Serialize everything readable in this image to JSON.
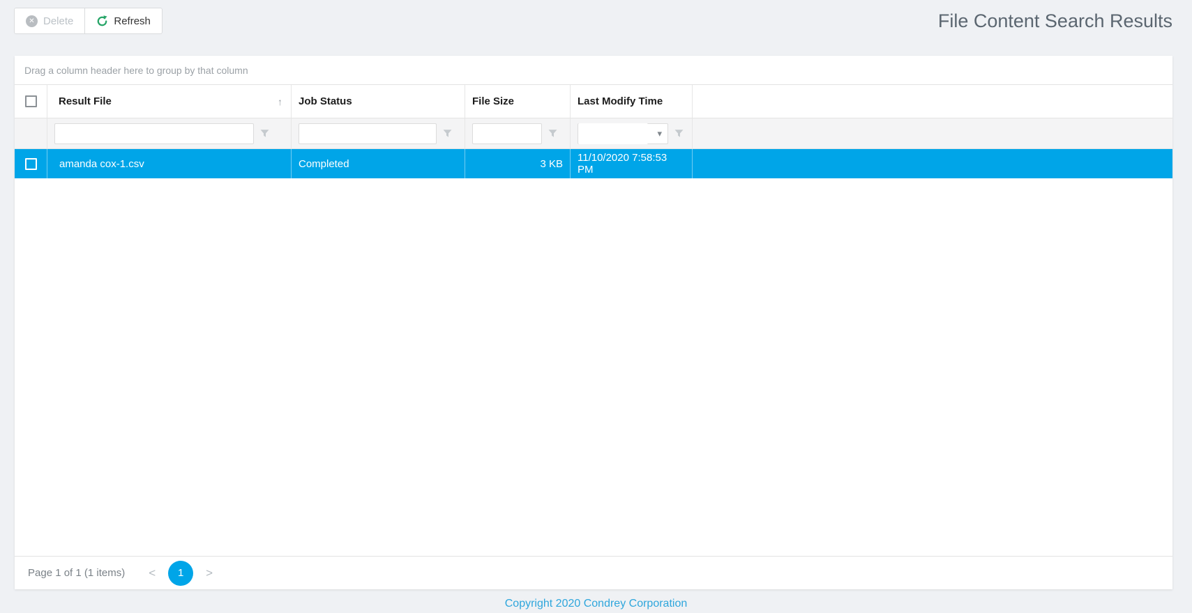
{
  "page": {
    "title": "File Content Search Results",
    "copyright": "Copyright 2020 Condrey Corporation"
  },
  "toolbar": {
    "delete_label": "Delete",
    "refresh_label": "Refresh",
    "delete_enabled": false
  },
  "grid": {
    "group_hint": "Drag a column header here to group by that column",
    "columns": [
      {
        "label": "Result File",
        "sorted": "ascending"
      },
      {
        "label": "Job Status"
      },
      {
        "label": "File Size"
      },
      {
        "label": "Last Modify Time"
      }
    ],
    "filter_row": {
      "result_file_value": "",
      "job_status_value": "",
      "file_size_value": "",
      "last_modify_time_value": ""
    },
    "rows": [
      {
        "selected": true,
        "checked": false,
        "result_file": "amanda cox-1.csv",
        "job_status": "Completed",
        "file_size": "3 KB",
        "last_modify_time": "11/10/2020 7:58:53 PM"
      }
    ],
    "pager": {
      "summary": "Page 1 of 1 (1 items)",
      "current_page": "1",
      "pages": [
        "1"
      ]
    }
  },
  "icons": {
    "delete_x": "✕",
    "sort_ascending": "↑",
    "dropdown_caret": "▾",
    "pager_prev": "<",
    "pager_next": ">"
  },
  "colors": {
    "selection_blue": "#00a5e8",
    "refresh_green": "#27a568",
    "copyright_blue": "#2ea6dc",
    "page_background": "#eff1f4"
  }
}
